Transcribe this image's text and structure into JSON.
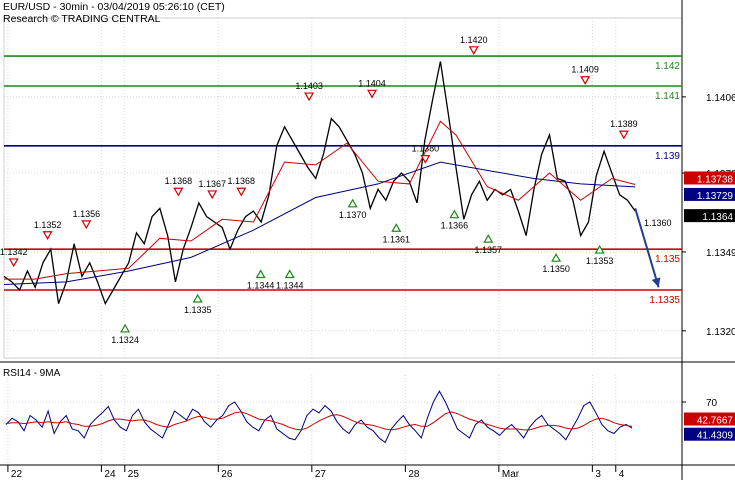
{
  "header": {
    "title": "EUR/USD - 30min - 03/04/2019 05:26:10 (CET)",
    "subtitle": "Research © TRADING CENTRAL"
  },
  "chart_data": [
    {
      "type": "line",
      "name": "price",
      "instrument": "EUR/USD",
      "timeframe": "30min",
      "ylim": [
        1.131,
        1.1435
      ],
      "grid": true,
      "y_ticks": [
        "1.1406",
        "1.1378",
        "1.1349",
        "1.1320"
      ],
      "x_ticks": [
        {
          "label": "22",
          "t": 0.5
        },
        {
          "label": "24",
          "t": 12.5
        },
        {
          "label": "25",
          "t": 15.5
        },
        {
          "label": "26",
          "t": 27.5
        },
        {
          "label": "27",
          "t": 39.5
        },
        {
          "label": "28",
          "t": 51.5
        },
        {
          "label": "Mar",
          "t": 63.5
        },
        {
          "label": "3",
          "t": 75.5
        },
        {
          "label": "4",
          "t": 78.5
        }
      ],
      "x_range": [
        0,
        87
      ],
      "levels": [
        {
          "label": "1.142",
          "value": 1.1421,
          "color": "#1a8a1a"
        },
        {
          "label": "1.141",
          "value": 1.141,
          "color": "#1a8a1a"
        },
        {
          "label": "1.139",
          "value": 1.1388,
          "color": "#000080"
        },
        {
          "label": "1.135",
          "value": 1.135,
          "color": "#cc0000"
        },
        {
          "label": "1.1335",
          "value": 1.1335,
          "color": "#cc0000"
        }
      ],
      "last_price": {
        "label": "1.1364",
        "value": 1.1364
      },
      "ma_fast_tag": {
        "label": "1.13738",
        "value": 1.13738,
        "color": "#cc0000"
      },
      "ma_slow_tag": {
        "label": "1.13729",
        "value": 1.13729,
        "color": "#000080"
      },
      "projection": {
        "from_t": 81,
        "from_value": 1.1365,
        "to_t": 84,
        "to_value": 1.1336
      },
      "series": [
        {
          "name": "close",
          "color": "#000000",
          "values": [
            [
              0,
              1.134
            ],
            [
              1,
              1.1338
            ],
            [
              2,
              1.1335
            ],
            [
              3,
              1.1342
            ],
            [
              4,
              1.1336
            ],
            [
              5,
              1.1345
            ],
            [
              6,
              1.135
            ],
            [
              7,
              1.133
            ],
            [
              8,
              1.1338
            ],
            [
              9,
              1.1352
            ],
            [
              10,
              1.134
            ],
            [
              11,
              1.1345
            ],
            [
              12,
              1.1338
            ],
            [
              13,
              1.133
            ],
            [
              14,
              1.1335
            ],
            [
              15,
              1.134
            ],
            [
              16,
              1.1345
            ],
            [
              17,
              1.1356
            ],
            [
              18,
              1.1352
            ],
            [
              19,
              1.1362
            ],
            [
              20,
              1.1365
            ],
            [
              21,
              1.1355
            ],
            [
              22,
              1.1338
            ],
            [
              23,
              1.135
            ],
            [
              24,
              1.1358
            ],
            [
              25,
              1.1367
            ],
            [
              26,
              1.1362
            ],
            [
              27,
              1.136
            ],
            [
              28,
              1.1358
            ],
            [
              29,
              1.135
            ],
            [
              30,
              1.1357
            ],
            [
              31,
              1.1362
            ],
            [
              32,
              1.1364
            ],
            [
              33,
              1.136
            ],
            [
              34,
              1.137
            ],
            [
              35,
              1.1388
            ],
            [
              36,
              1.1395
            ],
            [
              37,
              1.139
            ],
            [
              38,
              1.1385
            ],
            [
              39,
              1.138
            ],
            [
              40,
              1.1376
            ],
            [
              41,
              1.1385
            ],
            [
              42,
              1.1398
            ],
            [
              43,
              1.1395
            ],
            [
              44,
              1.139
            ],
            [
              45,
              1.1385
            ],
            [
              46,
              1.1378
            ],
            [
              47,
              1.1365
            ],
            [
              48,
              1.1372
            ],
            [
              49,
              1.1368
            ],
            [
              50,
              1.1375
            ],
            [
              51,
              1.1378
            ],
            [
              52,
              1.1375
            ],
            [
              53,
              1.1367
            ],
            [
              54,
              1.139
            ],
            [
              55,
              1.1405
            ],
            [
              56,
              1.1419
            ],
            [
              57,
              1.14
            ],
            [
              58,
              1.138
            ],
            [
              59,
              1.1361
            ],
            [
              60,
              1.137
            ],
            [
              61,
              1.1375
            ],
            [
              62,
              1.1368
            ],
            [
              63,
              1.1372
            ],
            [
              64,
              1.137
            ],
            [
              65,
              1.1372
            ],
            [
              66,
              1.1364
            ],
            [
              67,
              1.1355
            ],
            [
              68,
              1.1372
            ],
            [
              69,
              1.1385
            ],
            [
              70,
              1.1392
            ],
            [
              71,
              1.1376
            ],
            [
              72,
              1.1375
            ],
            [
              73,
              1.1368
            ],
            [
              74,
              1.1355
            ],
            [
              75,
              1.136
            ],
            [
              76,
              1.1377
            ],
            [
              77,
              1.1386
            ],
            [
              78,
              1.1378
            ],
            [
              79,
              1.137
            ],
            [
              80,
              1.1368
            ],
            [
              81,
              1.1364
            ]
          ]
        },
        {
          "name": "ma_fast",
          "color": "#cc0000",
          "values": [
            [
              0,
              1.1339
            ],
            [
              4,
              1.1339
            ],
            [
              8,
              1.1341
            ],
            [
              12,
              1.1342
            ],
            [
              16,
              1.1343
            ],
            [
              20,
              1.1354
            ],
            [
              24,
              1.1353
            ],
            [
              28,
              1.1361
            ],
            [
              32,
              1.136
            ],
            [
              36,
              1.1382
            ],
            [
              40,
              1.1381
            ],
            [
              44,
              1.1389
            ],
            [
              48,
              1.1375
            ],
            [
              52,
              1.1374
            ],
            [
              56,
              1.1397
            ],
            [
              58,
              1.1392
            ],
            [
              62,
              1.1373
            ],
            [
              66,
              1.1368
            ],
            [
              70,
              1.1378
            ],
            [
              74,
              1.1368
            ],
            [
              78,
              1.1376
            ],
            [
              81,
              1.13738
            ]
          ]
        },
        {
          "name": "ma_slow",
          "color": "#000080",
          "values": [
            [
              0,
              1.1337
            ],
            [
              8,
              1.1338
            ],
            [
              16,
              1.1342
            ],
            [
              24,
              1.1347
            ],
            [
              32,
              1.1357
            ],
            [
              40,
              1.1369
            ],
            [
              48,
              1.1374
            ],
            [
              56,
              1.1382
            ],
            [
              62,
              1.1379
            ],
            [
              68,
              1.1376
            ],
            [
              74,
              1.1374
            ],
            [
              81,
              1.13729
            ]
          ]
        }
      ],
      "annotations": [
        {
          "label": "1.1342",
          "t": 2,
          "value": 1.1342,
          "kind": "high"
        },
        {
          "label": "1.1352",
          "t": 9,
          "value": 1.1352,
          "kind": "high"
        },
        {
          "label": "1.1356",
          "t": 17,
          "value": 1.1356,
          "kind": "high"
        },
        {
          "label": "1.1324",
          "t": 25,
          "value": 1.1324,
          "kind": "low"
        },
        {
          "label": "1.1368",
          "t": 36,
          "value": 1.1368,
          "kind": "high"
        },
        {
          "label": "1.1335",
          "t": 40,
          "value": 1.1335,
          "kind": "low"
        },
        {
          "label": "1.1367",
          "t": 43,
          "value": 1.1367,
          "kind": "high"
        },
        {
          "label": "1.1368",
          "t": 49,
          "value": 1.1368,
          "kind": "high"
        },
        {
          "label": "1.1344",
          "t": 53,
          "value": 1.1344,
          "kind": "low"
        },
        {
          "label": "1.1344",
          "t": 59,
          "value": 1.1344,
          "kind": "low"
        },
        {
          "label": "1.1403",
          "t": 63,
          "value": 1.1403,
          "kind": "high"
        },
        {
          "label": "1.1370",
          "t": 72,
          "value": 1.137,
          "kind": "low"
        },
        {
          "label": "1.1404",
          "t": 76,
          "value": 1.1404,
          "kind": "high"
        },
        {
          "label": "1.1361",
          "t": 81,
          "value": 1.1361,
          "kind": "low"
        },
        {
          "label": "1.1380",
          "t": 87,
          "value": 1.138,
          "kind": "high"
        },
        {
          "label": "1.1366",
          "t": 93,
          "value": 1.1366,
          "kind": "low"
        },
        {
          "label": "1.1420",
          "t": 97,
          "value": 1.142,
          "kind": "high"
        },
        {
          "label": "1.1357",
          "t": 100,
          "value": 1.1357,
          "kind": "low"
        },
        {
          "label": "1.1350",
          "t": 114,
          "value": 1.135,
          "kind": "low"
        },
        {
          "label": "1.1409",
          "t": 120,
          "value": 1.1409,
          "kind": "high"
        },
        {
          "label": "1.1353",
          "t": 123,
          "value": 1.1353,
          "kind": "low"
        },
        {
          "label": "1.1389",
          "t": 128,
          "value": 1.1389,
          "kind": "high"
        },
        {
          "label": "1.1360",
          "t": 135,
          "value": 1.136,
          "kind": "plain"
        }
      ]
    },
    {
      "type": "line",
      "name": "rsi",
      "title": "RSI14 - 9MA",
      "ylim": [
        0,
        100
      ],
      "y_ticks": [
        "70"
      ],
      "rsi_tag": {
        "label": "41.4309",
        "value": 41.4309
      },
      "ma_tag": {
        "label": "42.7667",
        "value": 42.7667
      },
      "series": [
        {
          "name": "rsi",
          "color": "#000080",
          "values": [
            45,
            52,
            48,
            38,
            55,
            50,
            42,
            60,
            35,
            48,
            55,
            40,
            38,
            30,
            45,
            52,
            58,
            65,
            50,
            42,
            38,
            55,
            62,
            48,
            40,
            35,
            30,
            45,
            60,
            55,
            50,
            62,
            58,
            48,
            42,
            50,
            55,
            66,
            70,
            60,
            48,
            42,
            38,
            50,
            55,
            40,
            35,
            30,
            28,
            38,
            55,
            62,
            58,
            66,
            60,
            48,
            40,
            35,
            45,
            50,
            42,
            38,
            30,
            25,
            40,
            48,
            55,
            45,
            38,
            30,
            52,
            70,
            82,
            70,
            55,
            40,
            35,
            30,
            45,
            50,
            42,
            38,
            33,
            40,
            45,
            38,
            30,
            42,
            50,
            55,
            45,
            40,
            35,
            28,
            40,
            52,
            66,
            70,
            58,
            45,
            38,
            35,
            42,
            45,
            41
          ]
        },
        {
          "name": "ma",
          "color": "#cc0000",
          "values": [
            46,
            47,
            47,
            46,
            47,
            48,
            47,
            48,
            47,
            47,
            48,
            46,
            45,
            43,
            43,
            44,
            46,
            49,
            51,
            51,
            50,
            49,
            50,
            50,
            48,
            45,
            43,
            42,
            45,
            47,
            49,
            52,
            54,
            53,
            51,
            51,
            52,
            55,
            58,
            59,
            57,
            54,
            51,
            50,
            49,
            47,
            45,
            42,
            40,
            39,
            41,
            45,
            49,
            52,
            55,
            56,
            54,
            51,
            48,
            46,
            45,
            44,
            42,
            40,
            39,
            40,
            42,
            44,
            45,
            43,
            43,
            47,
            52,
            57,
            59,
            57,
            54,
            51,
            49,
            47,
            45,
            43,
            41,
            40,
            40,
            40,
            39,
            39,
            41,
            43,
            44,
            44,
            43,
            41,
            40,
            41,
            44,
            48,
            51,
            52,
            50,
            47,
            45,
            44,
            42.77
          ]
        }
      ]
    }
  ]
}
